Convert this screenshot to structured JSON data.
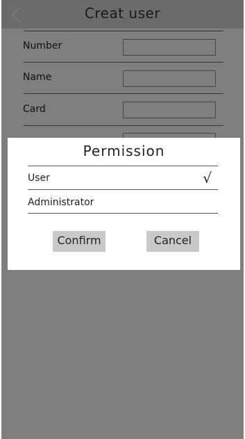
{
  "header": {
    "title": "Creat user",
    "back_icon": "chevron-left-icon"
  },
  "form": {
    "fields": [
      {
        "label": "Number",
        "value": ""
      },
      {
        "label": "Name",
        "value": ""
      },
      {
        "label": "Card",
        "value": ""
      },
      {
        "label": "",
        "value": ""
      }
    ]
  },
  "dialog": {
    "title": "Permission",
    "options": [
      {
        "label": "User",
        "selected": true,
        "check_mark": "√"
      },
      {
        "label": "Administrator",
        "selected": false,
        "check_mark": ""
      }
    ],
    "confirm_label": "Confirm",
    "cancel_label": "Cancel"
  },
  "colors": {
    "header_bg": "#d7d7d7",
    "overlay": "rgba(0,0,0,0.5)",
    "button_bg": "#c9c9c9"
  }
}
